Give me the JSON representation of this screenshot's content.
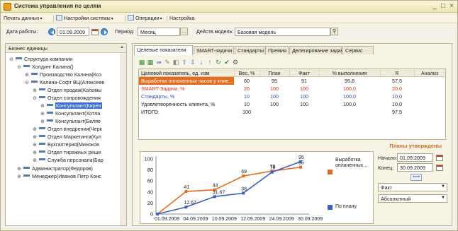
{
  "window": {
    "title": "Система управления по целям",
    "controls": [
      "_",
      "□",
      "×"
    ]
  },
  "menu": {
    "print": "Печать данных",
    "settings": "Настройки системы",
    "operations": "Операции",
    "setup": "Настройка"
  },
  "params": {
    "work_date_label": "Дата работы:",
    "work_date": "01.09.2009",
    "period_label": "Период:",
    "period": "Месяц",
    "model_label": "Действ.модель:",
    "model": "Базовая модель"
  },
  "tree": {
    "header": "Бизнес единицы",
    "items": [
      {
        "exp": "⊖",
        "label": "Структура компании"
      },
      {
        "exp": "⊖",
        "label": "Холдинг Калина()"
      },
      {
        "exp": "⊕",
        "label": "Производство Калина(Коз"
      },
      {
        "exp": "⊖",
        "label": "Калина-Софт ВЦ(Алексеев"
      },
      {
        "exp": "⊕",
        "label": "Отдел продаж(Коломы"
      },
      {
        "exp": "⊖",
        "label": "Отдел сопровождения"
      },
      {
        "exp": "⊕",
        "label": "Консультант(Кирея"
      },
      {
        "exp": "⊕",
        "label": "Консультант(Хотла"
      },
      {
        "exp": "⊕",
        "label": "Консультант(Беляе"
      },
      {
        "exp": "⊕",
        "label": "Отдел внедрения(Черк"
      },
      {
        "exp": "⊕",
        "label": "Отдел Маркетинга(Кул"
      },
      {
        "exp": "⊕",
        "label": "Бухгалтерия(Миноков"
      },
      {
        "exp": "⊕",
        "label": "Отдел тиражных реше"
      },
      {
        "exp": "⊕",
        "label": "Служба персонала(Бар"
      },
      {
        "exp": "⊕",
        "label": "Администратор(Федоров)"
      },
      {
        "exp": "⊕",
        "label": "Менеджер(Иванов Петр Конс"
      }
    ]
  },
  "tabs": [
    "Целевые показатели",
    "SMART-задачи",
    "Стандарты",
    "Премия",
    "Делегирование задач",
    "Сервис"
  ],
  "grid": {
    "headers": [
      "Целевой показатель, ед. изм",
      "Вес, %",
      "План",
      "Факт",
      "% выполнения",
      "R",
      "Анализ"
    ],
    "rows": [
      {
        "name": "Выработка оплаченных часов у клие...",
        "weight": "60",
        "plan": "95",
        "fact": "91",
        "pct": "95,8",
        "r": "57,5",
        "style": "orange"
      },
      {
        "name": "SMART-Задачи, %",
        "weight": "20",
        "plan": "100",
        "fact": "100",
        "pct": "100,0",
        "r": "20,0",
        "style": "red"
      },
      {
        "name": "Стандарты, %",
        "weight": "10",
        "plan": "100",
        "fact": "100",
        "pct": "100,0",
        "r": "10,0",
        "style": "blue"
      },
      {
        "name": "Удовлетворенность клиента, %",
        "weight": "10",
        "plan": "100",
        "fact": "100",
        "pct": "100,0",
        "r": "10,0",
        "style": "normal"
      }
    ],
    "total_label": "ИТОГО:",
    "total_weight": "100",
    "total_r": "97,5"
  },
  "approved": "Планы утверждены",
  "controls": {
    "start_label": "Начало:",
    "start": "01.09.2009",
    "end_label": "Конец:",
    "end": "30.09.2009",
    "period_shift": "⟺",
    "fact_select": "Факт",
    "absolute_select": "Абсолютный"
  },
  "colors": {
    "fact": "#e46c1e",
    "plan": "#3b5fc4",
    "accent": "#d06a20"
  },
  "chart_data": {
    "type": "line",
    "x": [
      "01.09.2009",
      "04.09.2009",
      "10.09.2009",
      "12.09.2009",
      "24.09.2009",
      "30.09.2009"
    ],
    "tick_labels": [
      "01.09.2009",
      "04.09.2009",
      "10.09.2009",
      "12.09.2009",
      "24.09.2009",
      "30.09.2009"
    ],
    "ylim": [
      0,
      100
    ],
    "yticks": [
      0,
      20,
      40,
      60,
      80,
      100
    ],
    "series": [
      {
        "name": "Выработка оплаченных...",
        "color": "#e46c1e",
        "values": [
          0,
          41,
          44,
          69,
          78,
          85
        ],
        "labels": [
          "",
          "41",
          "44",
          "69",
          "78",
          "85"
        ]
      },
      {
        "name": "По плану",
        "color": "#3b5fc4",
        "values": [
          0,
          12.67,
          31.67,
          38,
          76,
          95
        ],
        "labels": [
          "",
          "12.67",
          "31.67",
          "38",
          "76",
          "95"
        ]
      }
    ],
    "legend_position": "right"
  }
}
